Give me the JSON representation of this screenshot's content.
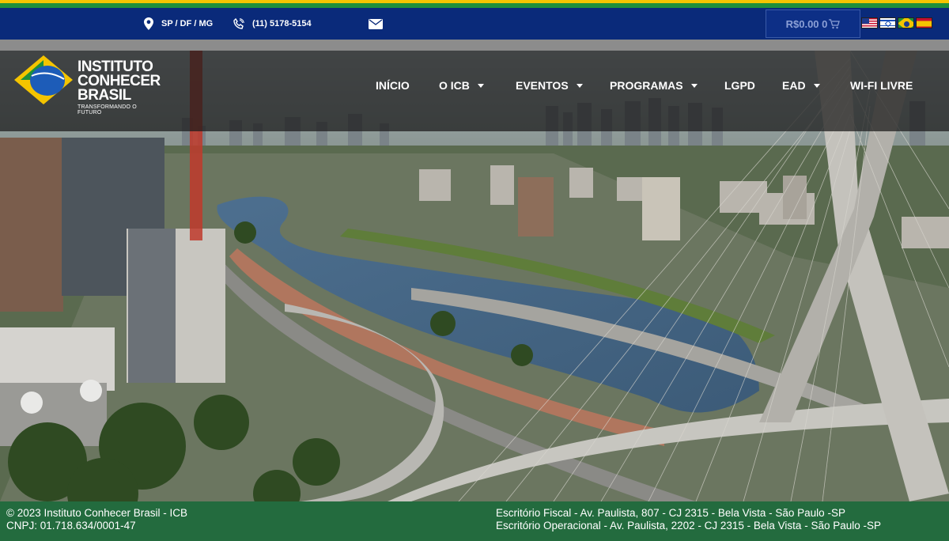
{
  "topbar": {
    "location": "SP / DF / MG",
    "phone": "(11) 5178-5154",
    "cart": "R$0.00 0"
  },
  "logo": {
    "title_line1": "INSTITUTO",
    "title_line2": "CONHECER",
    "title_line3": "BRASIL",
    "tagline": "TRANSFORMANDO O FUTURO"
  },
  "nav": {
    "items": [
      {
        "label": "INÍCIO"
      },
      {
        "label": "O ICB"
      },
      {
        "label": "EVENTOS"
      },
      {
        "label": "PROGRAMAS"
      },
      {
        "label": "LGPD"
      },
      {
        "label": "EAD"
      },
      {
        "label": "WI-FI LIVRE"
      }
    ]
  },
  "flags": [
    "us-flag-icon",
    "israel-flag-icon",
    "brazil-flag-icon",
    "spain-flag-icon"
  ],
  "colors": {
    "topbar": "#0a2a7a",
    "stripe_yellow": "#f4c400",
    "stripe_green": "#1e8f3b",
    "footer": "#236b3e"
  },
  "footer": {
    "copyright": "© 2023 Instituto Conhecer Brasil - ICB",
    "cnpj": "CNPJ: 01.718.634/0001-47",
    "office_fiscal": "Escritório Fiscal - Av. Paulista, 807 - CJ 2315 - Bela Vista - São Paulo -SP",
    "office_operacional": "Escritório Operacional - Av. Paulista, 2202 - CJ 2315 - Bela Vista - São Paulo -SP"
  }
}
